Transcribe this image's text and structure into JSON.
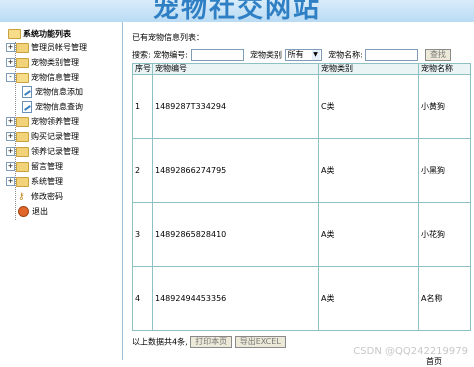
{
  "site": {
    "title": "宠物社交网站"
  },
  "sidebar": {
    "root_label": "系统功能列表",
    "items": [
      {
        "label": "管理员帐号管理",
        "expander": "+"
      },
      {
        "label": "宠物类别管理",
        "expander": "+"
      },
      {
        "label": "宠物信息管理",
        "expander": "-"
      },
      {
        "label": "宠物信息添加",
        "child": true
      },
      {
        "label": "宠物信息查询",
        "child": true
      },
      {
        "label": "宠物领养管理",
        "expander": "+"
      },
      {
        "label": "购买记录管理",
        "expander": "+"
      },
      {
        "label": "领养记录管理",
        "expander": "+"
      },
      {
        "label": "留言管理",
        "expander": "+"
      },
      {
        "label": "系统管理",
        "expander": "+"
      },
      {
        "label": "修改密码"
      },
      {
        "label": "退出"
      }
    ]
  },
  "main": {
    "heading": "已有宠物信息列表：",
    "search": {
      "label": "搜索:",
      "pet_no_label": "宠物编号:",
      "pet_no_value": "",
      "type_label": "宠物类别",
      "type_selected": "所有",
      "name_label": "宠物名称:",
      "name_value": "",
      "button": "查找"
    },
    "table": {
      "headers": [
        "序号",
        "宠物编号",
        "宠物类别",
        "宠物名称"
      ],
      "rows": [
        [
          "1",
          "1489287T334294",
          "C类",
          "小黄狗"
        ],
        [
          "2",
          "14892866274795",
          "A类",
          "小黑狗"
        ],
        [
          "3",
          "14892865828410",
          "A类",
          "小花狗"
        ],
        [
          "4",
          "14892494453356",
          "A类",
          "A名称"
        ]
      ]
    },
    "footer": {
      "count_text": "以上数据共4条,",
      "print_button": "打印本页",
      "export_button": "导出EXCEL"
    },
    "page_label": "首页"
  },
  "watermark": "CSDN @QQ242219979"
}
